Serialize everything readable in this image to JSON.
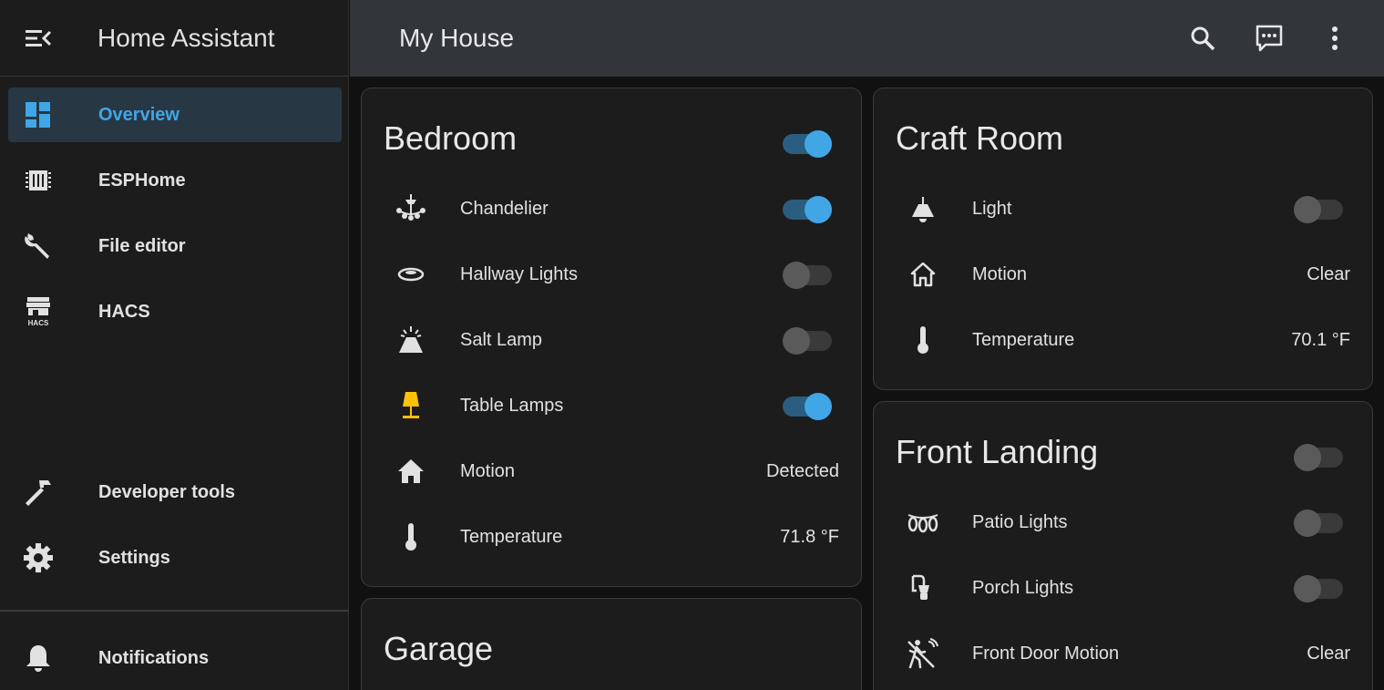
{
  "app": {
    "title": "Home Assistant"
  },
  "sidebar": {
    "items": [
      {
        "label": "Overview",
        "icon": "view-dashboard-icon",
        "active": true
      },
      {
        "label": "ESPHome",
        "icon": "chip-icon"
      },
      {
        "label": "File editor",
        "icon": "wrench-icon"
      },
      {
        "label": "HACS",
        "icon": "hacs-store-icon",
        "icon_text": "HACS"
      }
    ],
    "bottom_items": [
      {
        "label": "Developer tools",
        "icon": "hammer-icon"
      },
      {
        "label": "Settings",
        "icon": "cog-icon"
      }
    ],
    "notifications": {
      "label": "Notifications",
      "icon": "bell-icon"
    }
  },
  "topbar": {
    "title": "My House",
    "actions": [
      "search-icon",
      "assist-message-icon",
      "more-vert-icon"
    ]
  },
  "cards": {
    "bedroom": {
      "title": "Bedroom",
      "header_toggle": true,
      "rows": [
        {
          "name": "Chandelier",
          "icon": "chandelier-icon",
          "toggle": true
        },
        {
          "name": "Hallway Lights",
          "icon": "ceiling-light-icon",
          "toggle": false
        },
        {
          "name": "Salt Lamp",
          "icon": "salt-lamp-icon",
          "toggle": false
        },
        {
          "name": "Table Lamps",
          "icon": "table-lamp-icon",
          "toggle": true,
          "icon_color": "#ffc107"
        },
        {
          "name": "Motion",
          "icon": "home-icon",
          "state": "Detected"
        },
        {
          "name": "Temperature",
          "icon": "thermometer-icon",
          "state": "71.8 °F"
        }
      ]
    },
    "garage": {
      "title": "Garage"
    },
    "craft_room": {
      "title": "Craft Room",
      "rows": [
        {
          "name": "Light",
          "icon": "pendant-light-icon",
          "toggle": false
        },
        {
          "name": "Motion",
          "icon": "home-outline-icon",
          "state": "Clear"
        },
        {
          "name": "Temperature",
          "icon": "thermometer-icon",
          "state": "70.1 °F"
        }
      ]
    },
    "front_landing": {
      "title": "Front Landing",
      "header_toggle": false,
      "rows": [
        {
          "name": "Patio Lights",
          "icon": "string-lights-icon",
          "toggle": false
        },
        {
          "name": "Porch Lights",
          "icon": "outdoor-lamp-icon",
          "toggle": false
        },
        {
          "name": "Front Door Motion",
          "icon": "motion-sensor-icon",
          "state": "Clear"
        }
      ]
    }
  },
  "colors": {
    "accent": "#41a6e6",
    "sidebar_bg": "#1c1c1c",
    "topbar_bg": "#32363a",
    "card_bg": "#1c1c1c",
    "active_item_bg": "#283744",
    "lamp_on": "#ffc107"
  }
}
